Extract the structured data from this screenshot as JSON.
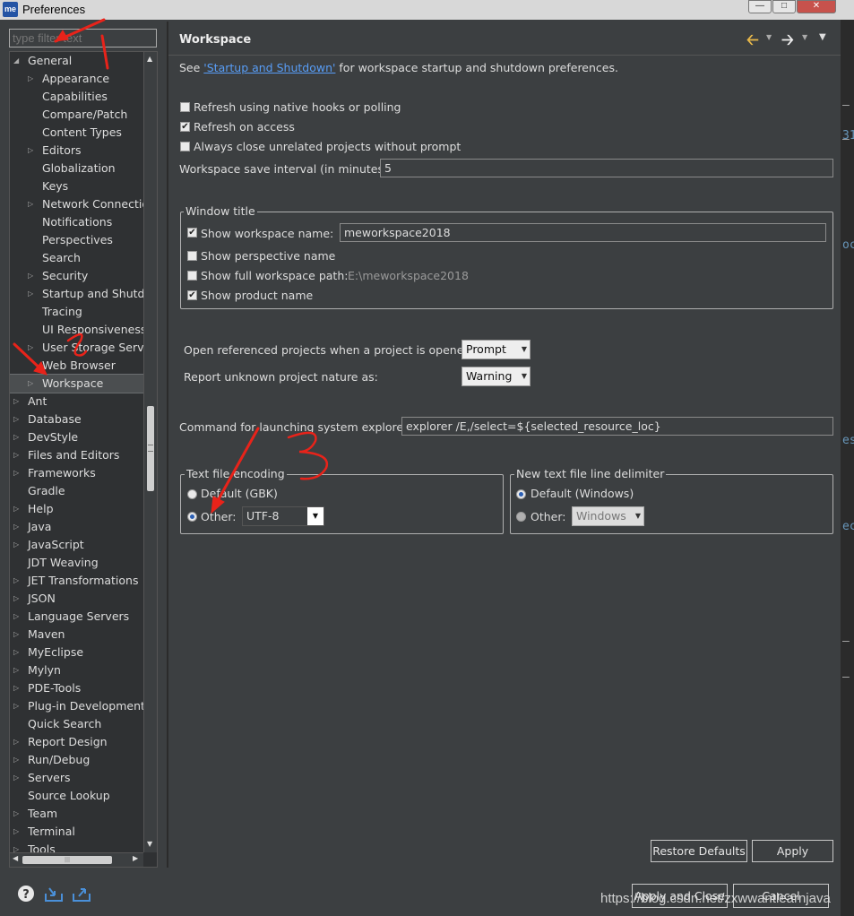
{
  "window": {
    "title": "Preferences",
    "app_icon": "me"
  },
  "filter": {
    "placeholder": "type filter text"
  },
  "tree": {
    "items": [
      {
        "label": "General",
        "expanded": true
      },
      {
        "label": "Appearance",
        "child": true
      },
      {
        "label": "Capabilities",
        "child": true
      },
      {
        "label": "Compare/Patch",
        "child": true
      },
      {
        "label": "Content Types",
        "child": true
      },
      {
        "label": "Editors",
        "child": true
      },
      {
        "label": "Globalization",
        "child": true
      },
      {
        "label": "Keys",
        "child": true
      },
      {
        "label": "Network Connections",
        "child": true
      },
      {
        "label": "Notifications",
        "child": true
      },
      {
        "label": "Perspectives",
        "child": true
      },
      {
        "label": "Search",
        "child": true
      },
      {
        "label": "Security",
        "child": true
      },
      {
        "label": "Startup and Shutdown",
        "child": true
      },
      {
        "label": "Tracing",
        "child": true
      },
      {
        "label": "UI Responsiveness",
        "child": true
      },
      {
        "label": "User Storage Service",
        "child": true
      },
      {
        "label": "Web Browser",
        "child": true
      },
      {
        "label": "Workspace",
        "child": true,
        "selected": true
      },
      {
        "label": "Ant"
      },
      {
        "label": "Database"
      },
      {
        "label": "DevStyle"
      },
      {
        "label": "Files and Editors"
      },
      {
        "label": "Frameworks"
      },
      {
        "label": "Gradle"
      },
      {
        "label": "Help"
      },
      {
        "label": "Java"
      },
      {
        "label": "JavaScript"
      },
      {
        "label": "JDT Weaving"
      },
      {
        "label": "JET Transformations"
      },
      {
        "label": "JSON"
      },
      {
        "label": "Language Servers"
      },
      {
        "label": "Maven"
      },
      {
        "label": "MyEclipse"
      },
      {
        "label": "Mylyn"
      },
      {
        "label": "PDE-Tools"
      },
      {
        "label": "Plug-in Development"
      },
      {
        "label": "Quick Search"
      },
      {
        "label": "Report Design"
      },
      {
        "label": "Run/Debug"
      },
      {
        "label": "Servers"
      },
      {
        "label": "Source Lookup"
      },
      {
        "label": "Team"
      },
      {
        "label": "Terminal"
      },
      {
        "label": "Tools"
      }
    ]
  },
  "page": {
    "title": "Workspace",
    "see_prefix": "See ",
    "see_link": "'Startup and Shutdown'",
    "see_suffix": " for workspace startup and shutdown preferences.",
    "refresh_native": "Refresh using native hooks or polling",
    "refresh_access": "Refresh on access",
    "always_close": "Always close unrelated projects without prompt",
    "save_interval_label": "Workspace save interval (in minutes):",
    "save_interval_value": "5",
    "window_title": {
      "legend": "Window title",
      "show_name": "Show workspace name:",
      "name_value": "meworkspace2018",
      "show_perspective": "Show perspective name",
      "show_full_path": "Show full workspace path:",
      "full_path_value": "E:\\meworkspace2018",
      "show_product": "Show product name"
    },
    "open_ref_label": "Open referenced projects when a project is opened:",
    "open_ref_value": "Prompt",
    "report_unknown_label": "Report unknown project nature as:",
    "report_unknown_value": "Warning",
    "command_label": "Command for launching system explorer:",
    "command_value": "explorer /E,/select=${selected_resource_loc}",
    "encoding": {
      "legend": "Text file encoding",
      "default": "Default (GBK)",
      "other": "Other:",
      "other_value": "UTF-8"
    },
    "delimiter": {
      "legend": "New text file line delimiter",
      "default": "Default (Windows)",
      "other": "Other:",
      "other_value": "Windows"
    },
    "restore_defaults": "Restore Defaults",
    "apply": "Apply"
  },
  "footer": {
    "apply_close": "Apply and Close",
    "cancel": "Cancel",
    "icons": [
      "help-icon",
      "import-icon",
      "export-icon"
    ]
  },
  "watermark": "https://blog.csdn.net/zxwwantlearnjava",
  "annotations": [
    "1",
    "2",
    "3"
  ]
}
